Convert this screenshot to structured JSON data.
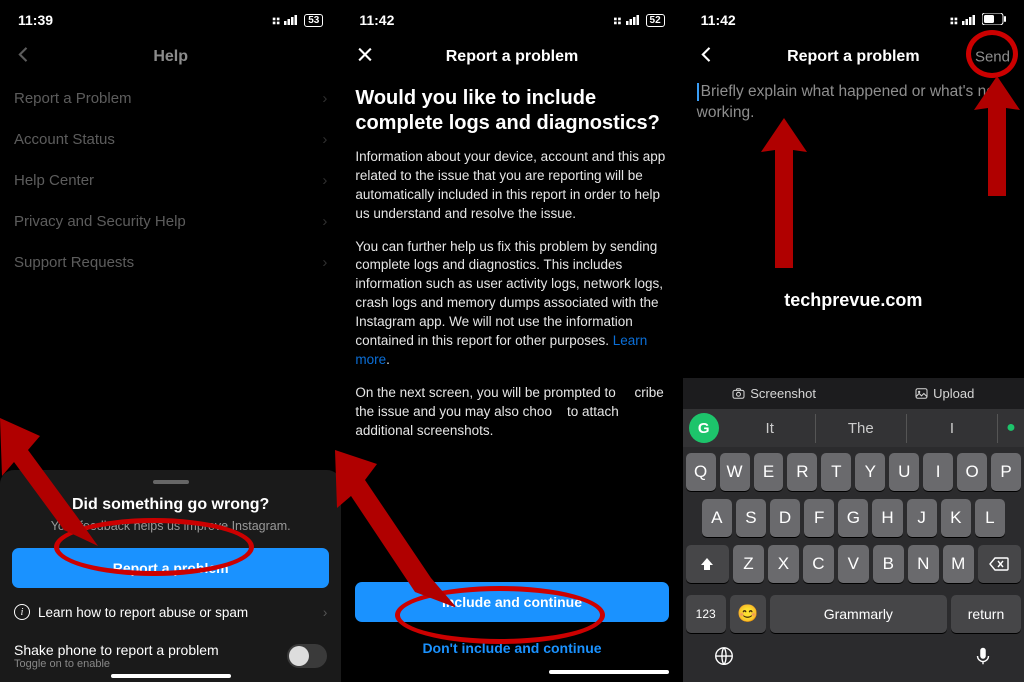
{
  "screen1": {
    "time": "11:39",
    "battery": "53",
    "header": "Help",
    "menu": [
      "Report a Problem",
      "Account Status",
      "Help Center",
      "Privacy and Security Help",
      "Support Requests"
    ],
    "sheet": {
      "title": "Did something go wrong?",
      "sub": "Your feedback helps us improve Instagram.",
      "primary": "Report a problem",
      "learn": "Learn how to report abuse or spam",
      "shake": "Shake phone to report a problem",
      "shake_sub": "Toggle on to enable"
    }
  },
  "screen2": {
    "time": "11:42",
    "battery": "52",
    "header": "Report a problem",
    "h1": "Would you like to include complete logs and diagnostics?",
    "p1": "Information about your device, account and this app related to the issue that you are reporting will be automatically included in this report in order to help us understand and resolve the issue.",
    "p2a": "You can further help us fix this problem by sending complete logs and diagnostics. This includes information such as user activity logs, network logs, crash logs and memory dumps associated with the Instagram app. We will not use the information contained in this report for other purposes. ",
    "p2_link": "Learn more",
    "p3a": "On the next screen, you will be prompted to ",
    "p3b": "cribe the issue and you may also choo",
    "p3c": "to attach additional screenshots.",
    "btn_primary": "Include and continue",
    "btn_sec": "Don't include and continue"
  },
  "screen3": {
    "time": "11:42",
    "header": "Report a problem",
    "send": "Send",
    "placeholder": "Briefly explain what happened or what's not working.",
    "watermark": "techprevue.com",
    "kb_top": {
      "shot": "Screenshot",
      "upload": "Upload"
    },
    "sugg": [
      "It",
      "The",
      "I"
    ],
    "row1": [
      "Q",
      "W",
      "E",
      "R",
      "T",
      "Y",
      "U",
      "I",
      "O",
      "P"
    ],
    "row2": [
      "A",
      "S",
      "D",
      "F",
      "G",
      "H",
      "J",
      "K",
      "L"
    ],
    "row3": [
      "Z",
      "X",
      "C",
      "V",
      "B",
      "N",
      "M"
    ],
    "n123": "123",
    "space": "Grammarly",
    "ret": "return",
    "g": "G"
  }
}
